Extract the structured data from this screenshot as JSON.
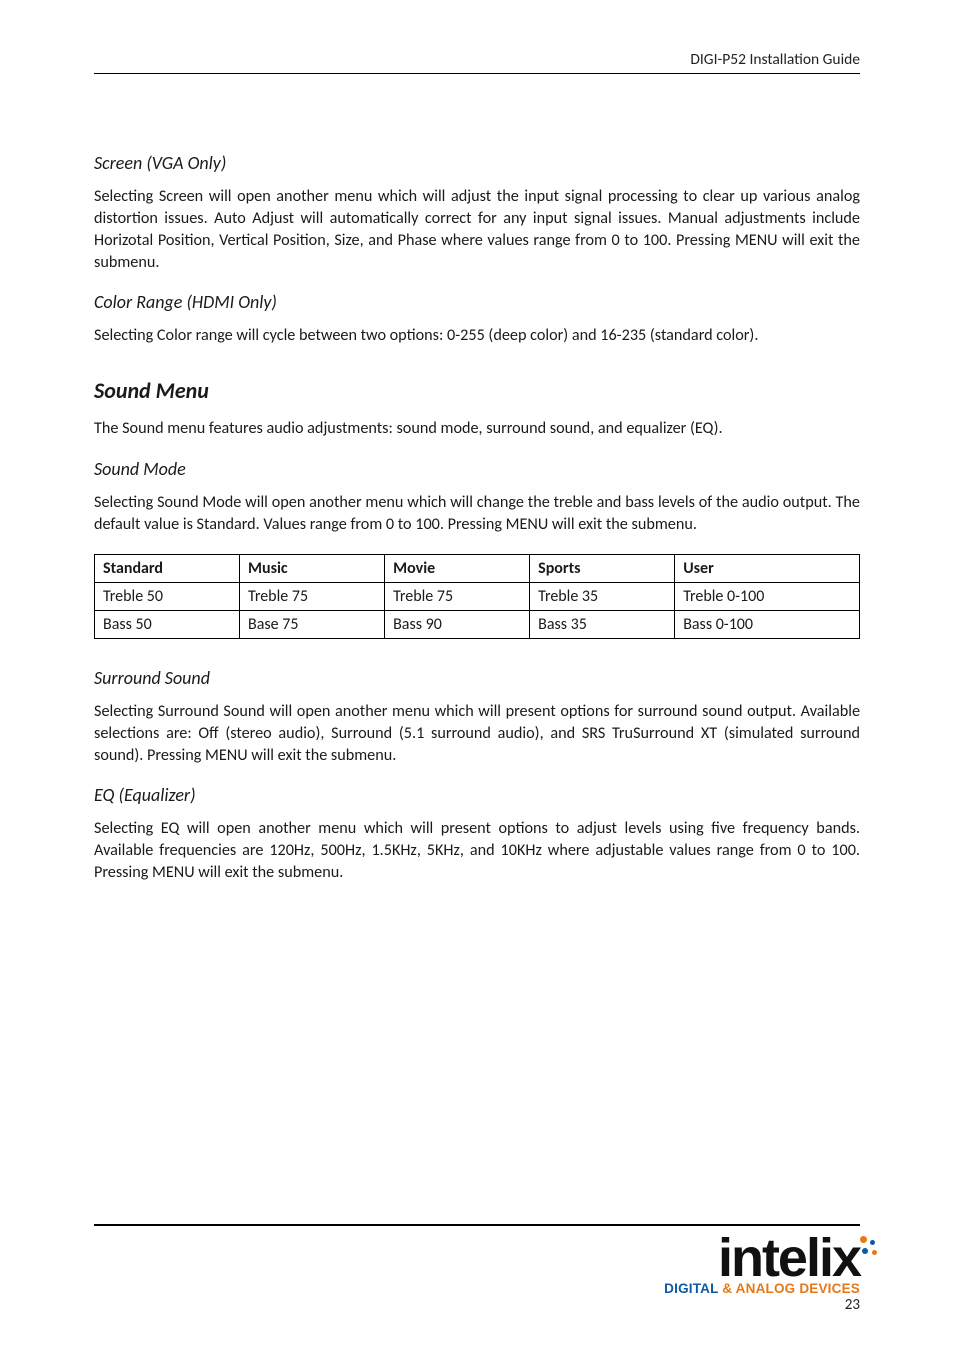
{
  "header": {
    "title": "DIGI-P52 Installation Guide"
  },
  "sections": {
    "screen": {
      "heading": "Screen (VGA Only)",
      "body": "Selecting Screen will open another menu which will adjust the input signal processing to clear up various analog distortion issues. Auto Adjust will automatically correct for any input signal issues. Manual adjustments include Horizotal Position, Vertical Position, Size, and Phase where values range from 0 to 100. Pressing MENU will exit the submenu."
    },
    "colorRange": {
      "heading": "Color Range (HDMI Only)",
      "body": "Selecting Color range will cycle between two options: 0-255 (deep color) and 16-235 (standard color)."
    },
    "soundMenu": {
      "heading": "Sound Menu",
      "intro": "The Sound menu features audio adjustments: sound mode, surround sound, and equalizer (EQ)."
    },
    "soundMode": {
      "heading": "Sound Mode",
      "body": "Selecting Sound Mode will open another menu which will change the treble and bass levels of the audio output. The default value is Standard. Values range from 0 to 100. Pressing MENU will exit the submenu."
    },
    "surround": {
      "heading": "Surround Sound",
      "body": "Selecting Surround Sound will open another menu which will present options for surround sound output. Available selections are: Off (stereo audio), Surround (5.1 surround audio), and SRS TruSurround XT (simulated surround sound). Pressing MENU will exit the submenu."
    },
    "eq": {
      "heading": "EQ (Equalizer)",
      "body": "Selecting EQ will open another menu which will present options to adjust levels using five frequency bands. Available frequencies are 120Hz, 500Hz, 1.5KHz, 5KHz, and 10KHz where adjustable values range from 0 to 100. Pressing MENU will exit the submenu."
    }
  },
  "soundTable": {
    "headers": [
      "Standard",
      "Music",
      "Movie",
      "Sports",
      "User"
    ],
    "rows": [
      [
        "Treble 50",
        "Treble 75",
        "Treble 75",
        "Treble 35",
        "Treble 0-100"
      ],
      [
        "Bass 50",
        "Base 75",
        "Bass 90",
        "Bass 35",
        "Bass 0-100"
      ]
    ]
  },
  "footer": {
    "logoMain": "intelix",
    "logoSubDigital": "DIGITAL ",
    "logoSubAmp": "& ANALOG DEVICES",
    "pageNumber": "23"
  }
}
